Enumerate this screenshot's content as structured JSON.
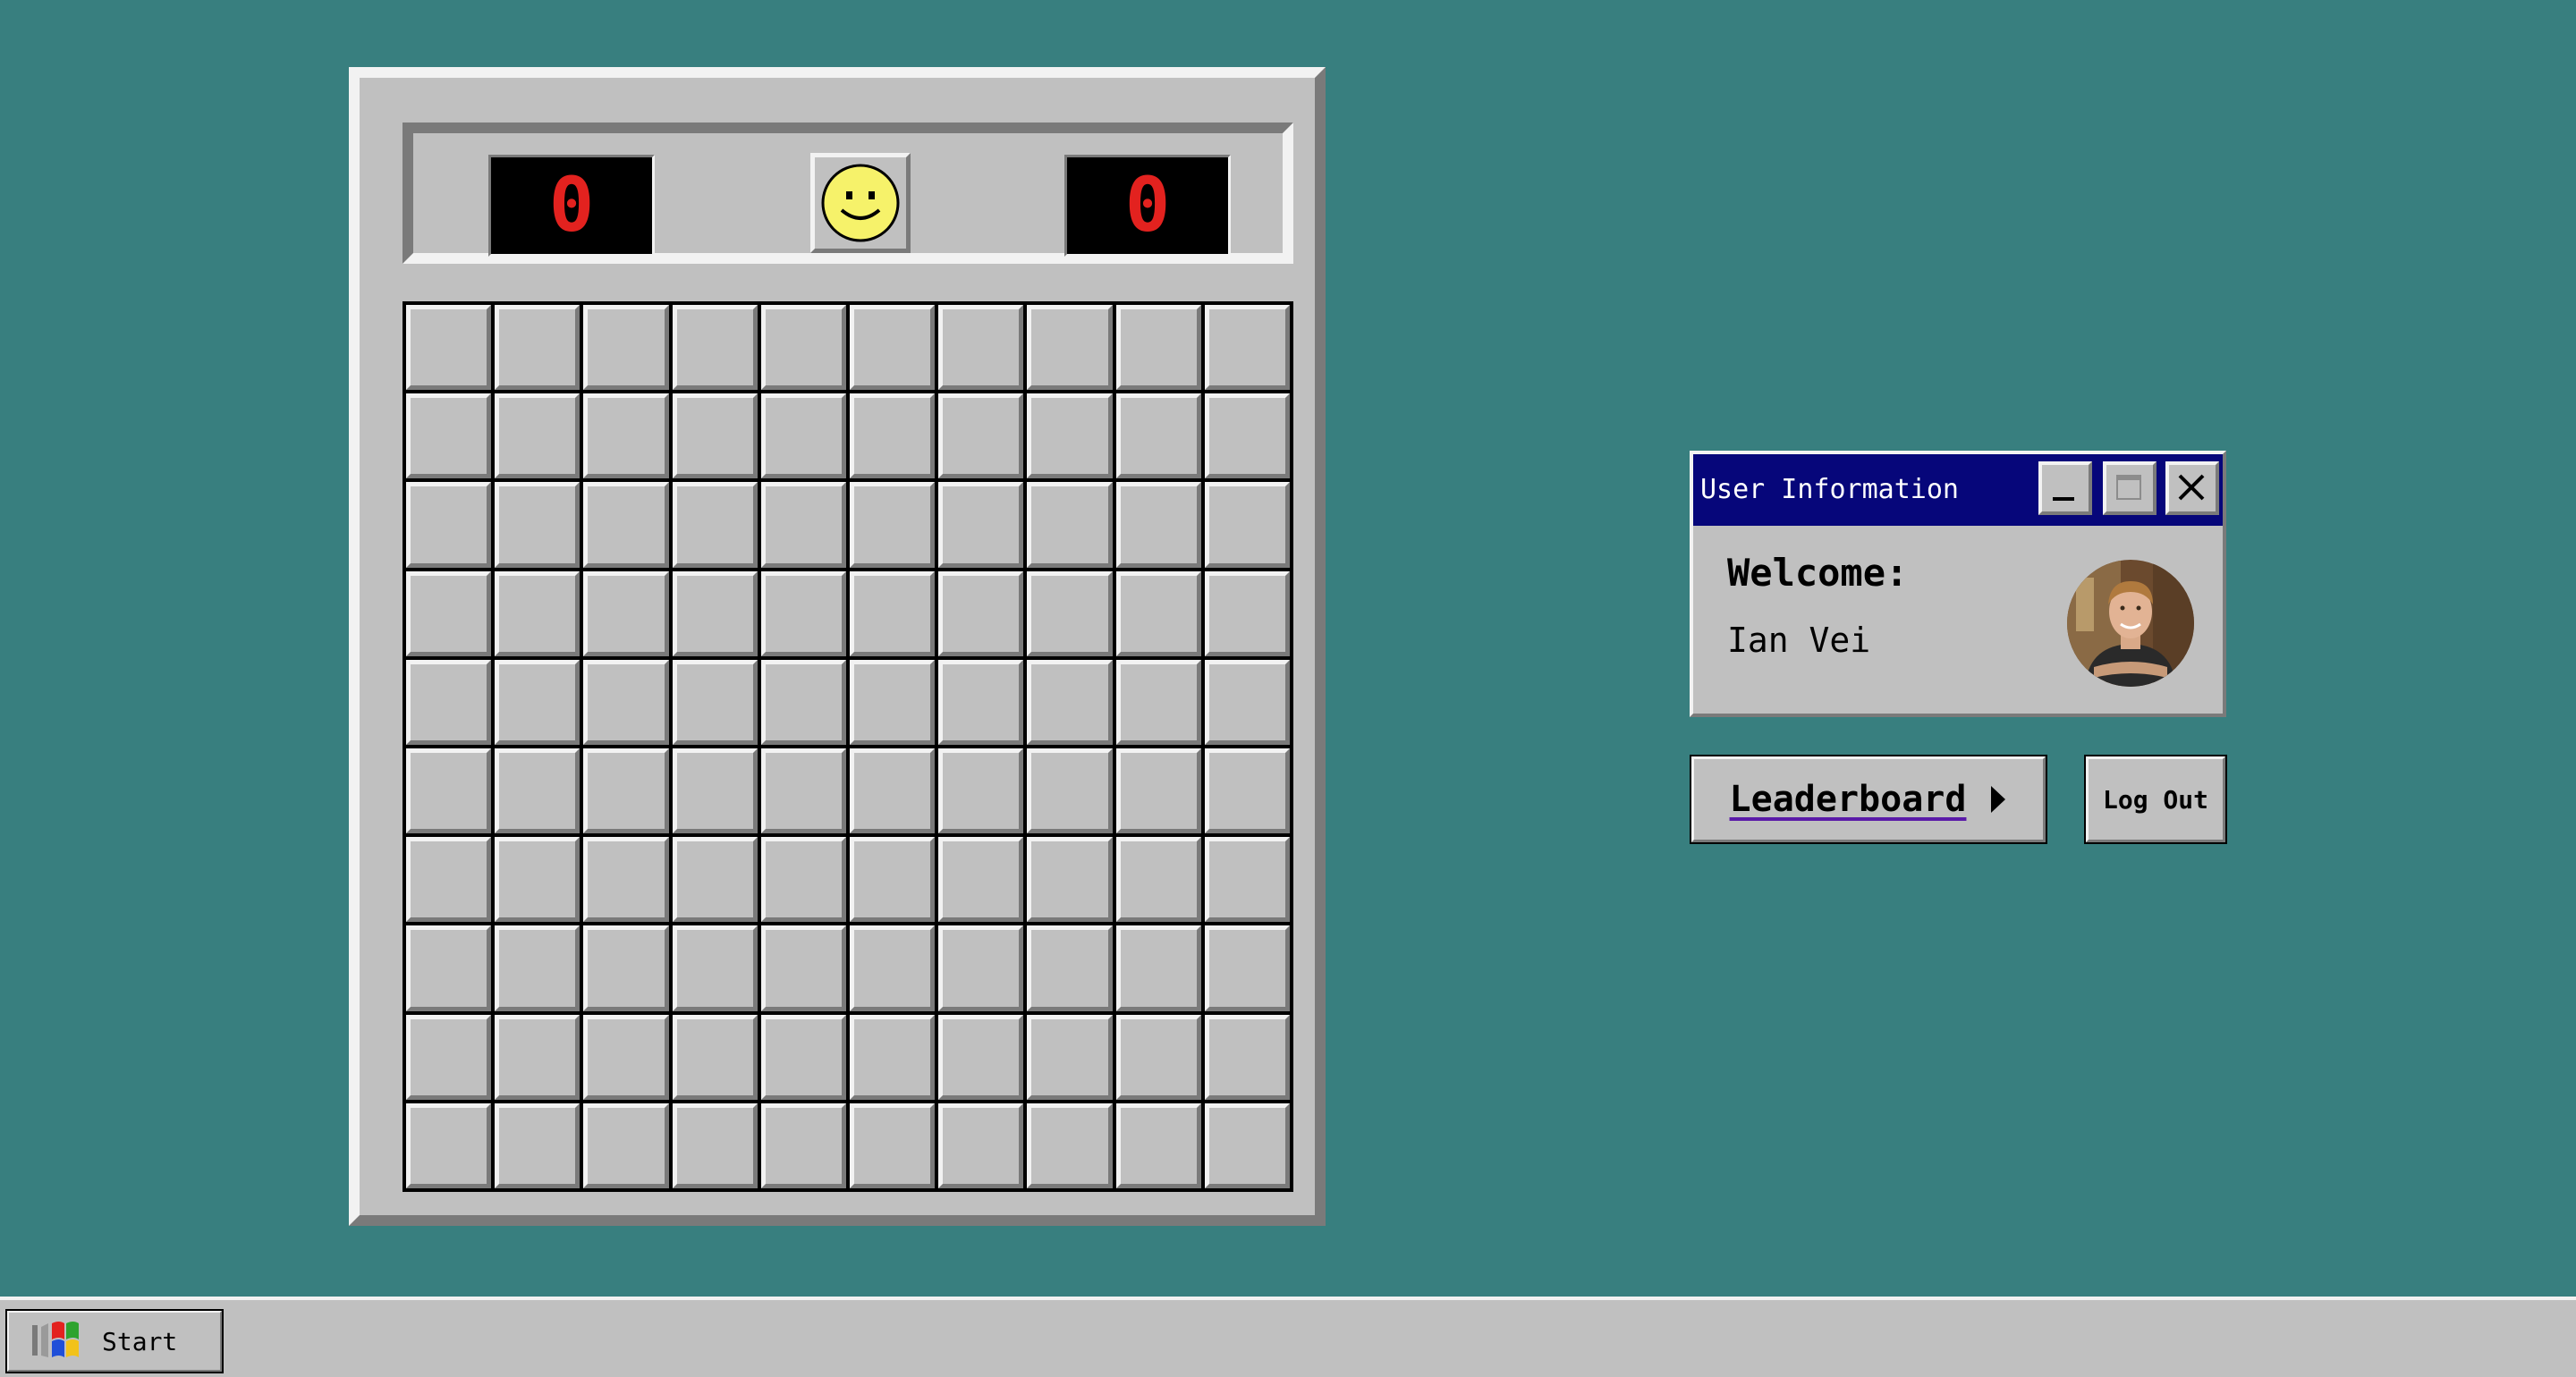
{
  "minesweeper": {
    "mine_count": "0",
    "timer": "0",
    "face": "smiley-face-icon",
    "grid": {
      "rows": 10,
      "cols": 10
    }
  },
  "user_window": {
    "title": "User Information",
    "welcome_label": "Welcome:",
    "user_name": "Ian Vei",
    "buttons": [
      "minimize-icon",
      "maximize-icon",
      "close-icon"
    ]
  },
  "actions": {
    "leaderboard_label": "Leaderboard",
    "logout_label": "Log Out"
  },
  "taskbar": {
    "start_label": "Start"
  },
  "colors": {
    "desktop": "#387f7f",
    "window_face": "#c0c0c0",
    "title_bar": "#06067a",
    "counter_digits": "#e3221f"
  }
}
